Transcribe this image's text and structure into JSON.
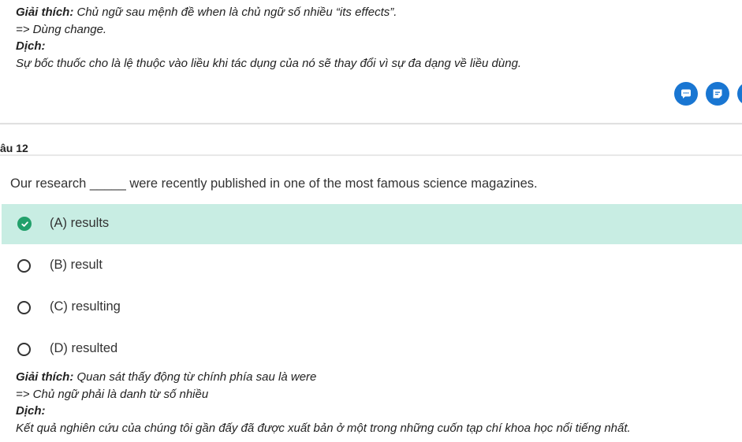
{
  "prev_explanation": {
    "label": "Giải thích:",
    "text": " Chủ ngữ sau mệnh đề when là chủ ngữ số nhiều “its effects”.",
    "conclusion": "=> Dùng change.",
    "translate_label": "Dịch:",
    "translation": "Sự bốc thuốc cho là lệ thuộc vào liều khi tác dụng của nó sẽ thay đổi vì sự đa dạng về liều dùng."
  },
  "fab": {
    "color": "#1976d2",
    "icons": [
      "comment-icon",
      "note-icon",
      "more-icon"
    ]
  },
  "question": {
    "header": "âu 12",
    "text": "Our research _____ were recently published in one of the most famous science magazines.",
    "options": [
      {
        "label": "(A) results",
        "correct": true
      },
      {
        "label": "(B) result",
        "correct": false
      },
      {
        "label": "(C) resulting",
        "correct": false
      },
      {
        "label": "(D) resulted",
        "correct": false
      }
    ],
    "correct_color": "#c8ede3"
  },
  "explanation": {
    "label": "Giải thích:",
    "text": " Quan sát thấy động từ chính phía sau là were",
    "conclusion": "=> Chủ ngữ phải là danh từ số nhiều",
    "translate_label": "Dịch:",
    "translation": "Kết quả nghiên cứu của chúng tôi gần đấy đã được xuất bản ở một trong những cuốn tạp chí khoa học nổi tiếng nhất."
  }
}
